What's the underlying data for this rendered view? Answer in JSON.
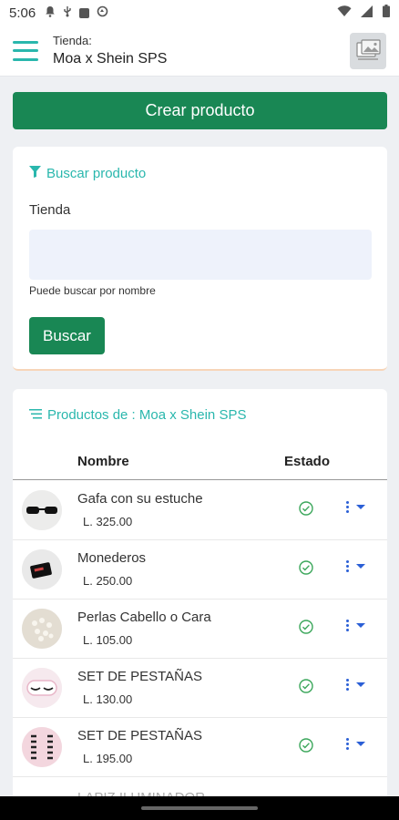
{
  "status_bar": {
    "time": "5:06"
  },
  "header": {
    "store_caption": "Tienda:",
    "store_name": "Moa x Shein SPS"
  },
  "actions": {
    "create_label": "Crear producto"
  },
  "search": {
    "title": "Buscar producto",
    "field_label": "Tienda",
    "field_value": "",
    "help_text": "Puede buscar por nombre",
    "button_label": "Buscar"
  },
  "products": {
    "title": "Productos de : Moa x Shein SPS",
    "columns": {
      "name": "Nombre",
      "status": "Estado"
    },
    "items": [
      {
        "name": "Gafa con su estuche",
        "price": "L. 325.00",
        "thumb": "sunglasses"
      },
      {
        "name": "Monederos",
        "price": "L. 250.00",
        "thumb": "wallet"
      },
      {
        "name": "Perlas Cabello o Cara",
        "price": "L. 105.00",
        "thumb": "pearls"
      },
      {
        "name": "SET DE PESTAÑAS",
        "price": "L. 130.00",
        "thumb": "lashes"
      },
      {
        "name": "SET DE PESTAÑAS",
        "price": "L. 195.00",
        "thumb": "lashes-set"
      }
    ],
    "partial_item": "LAPIZ ILUMINADOR"
  },
  "colors": {
    "accent": "#2ab7ad",
    "primary": "#198754",
    "status_ok": "#3aa65a",
    "menu": "#2b5fd6"
  }
}
